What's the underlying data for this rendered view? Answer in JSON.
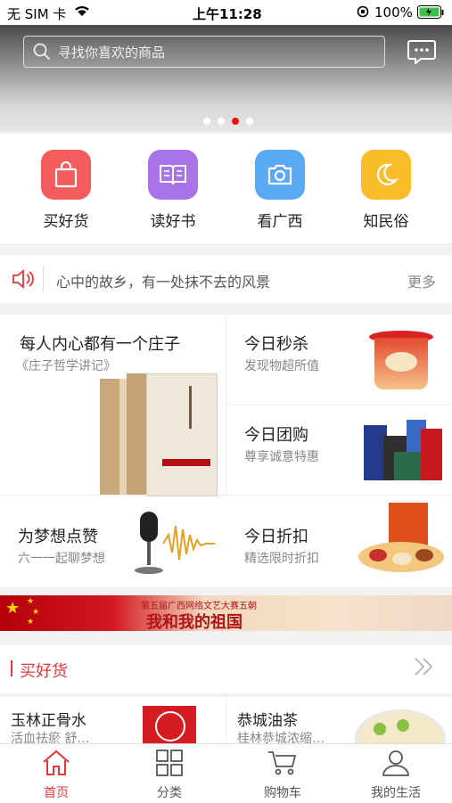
{
  "status": {
    "carrier": "无 SIM 卡",
    "time": "上午11:28",
    "battery": "100%"
  },
  "search": {
    "placeholder": "寻找你喜欢的商品"
  },
  "categories": [
    {
      "label": "买好货",
      "icon": "shopping-bag-icon",
      "color": "#f25c5c"
    },
    {
      "label": "读好书",
      "icon": "book-icon",
      "color": "#a874e8"
    },
    {
      "label": "看广西",
      "icon": "camera-icon",
      "color": "#5aa9f5"
    },
    {
      "label": "知民俗",
      "icon": "moon-icon",
      "color": "#f9bd2a"
    }
  ],
  "notice": {
    "text": "心中的故乡，有一处抹不去的风景",
    "more": "更多"
  },
  "promos": {
    "book": {
      "title": "每人内心都有一个庄子",
      "subtitle": "《庄子哲学讲记》"
    },
    "flash": {
      "title": "今日秒杀",
      "subtitle": "发现物超所值"
    },
    "group": {
      "title": "今日团购",
      "subtitle": "尊享诚意特惠"
    },
    "dream": {
      "title": "为梦想点赞",
      "subtitle": "六一一起聊梦想"
    },
    "discount": {
      "title": "今日折扣",
      "subtitle": "精选限时折扣"
    }
  },
  "flag_banner": {
    "small": "第五届广西网络文艺大赛五朝",
    "big": "我和我的祖国"
  },
  "section": {
    "title": "买好货"
  },
  "products": [
    {
      "name": "玉林正骨水",
      "desc": "活血祛瘀 舒…"
    },
    {
      "name": "恭城油茶",
      "desc": "桂林恭城浓缩…"
    }
  ],
  "tabs": [
    {
      "label": "首页",
      "icon": "home-icon"
    },
    {
      "label": "分类",
      "icon": "grid-icon"
    },
    {
      "label": "购物车",
      "icon": "cart-icon"
    },
    {
      "label": "我的生活",
      "icon": "user-icon"
    }
  ],
  "colors": {
    "accent": "#e4393c"
  }
}
